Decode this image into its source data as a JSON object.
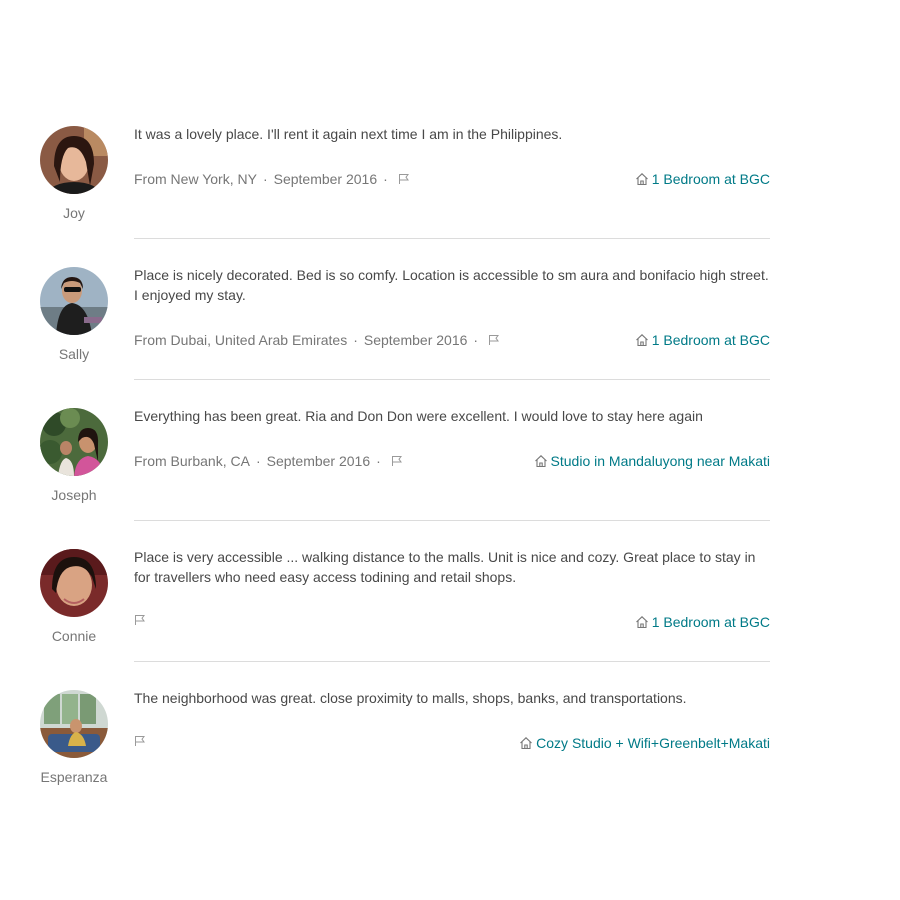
{
  "accent_color": "#007a87",
  "reviews": [
    {
      "name": "Joy",
      "comment": "It was a lovely place. I'll rent it again next time I am in the Philippines.",
      "location": "From New York, NY",
      "date": "September 2016",
      "listing": "1 Bedroom at BGC",
      "flag_icon": "flag-icon",
      "listing_icon": "home-icon"
    },
    {
      "name": "Sally",
      "comment": "Place is nicely decorated. Bed is so comfy. Location is accessible to sm aura and bonifacio high street. I enjoyed my stay.",
      "location": "From Dubai, United Arab Emirates",
      "date": "September 2016",
      "listing": "1 Bedroom at BGC",
      "flag_icon": "flag-icon",
      "listing_icon": "home-icon"
    },
    {
      "name": "Joseph",
      "comment": "Everything has been great. Ria and Don Don were excellent. I would love to stay here again",
      "location": "From Burbank, CA",
      "date": "September 2016",
      "listing": "Studio in Mandaluyong near Makati",
      "flag_icon": "flag-icon",
      "listing_icon": "home-icon"
    },
    {
      "name": "Connie",
      "comment": "Place is very accessible ... walking distance to the malls. Unit is nice and cozy. Great place to stay in for travellers who need easy access todining and retail shops.",
      "listing": "1 Bedroom at BGC",
      "flag_icon": "flag-icon",
      "listing_icon": "home-icon"
    },
    {
      "name": "Esperanza",
      "comment": "The neighborhood was great. close proximity to malls, shops, banks, and transportations.",
      "listing": "Cozy Studio + Wifi+Greenbelt+Makati",
      "flag_icon": "flag-icon",
      "listing_icon": "home-icon"
    }
  ]
}
